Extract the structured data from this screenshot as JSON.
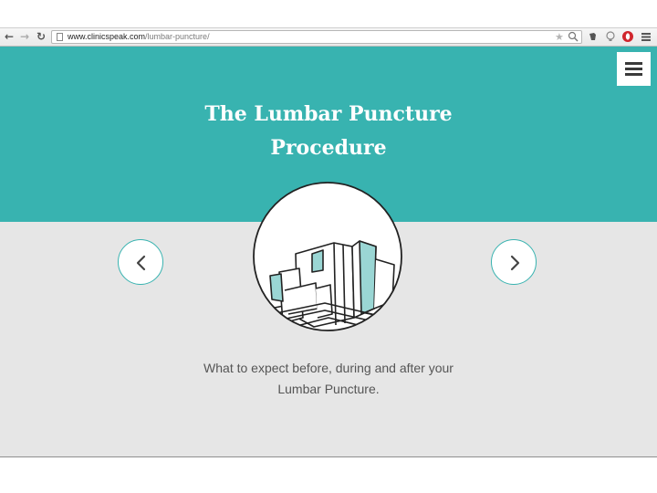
{
  "browser": {
    "url_domain": "www.clinicspeak.com",
    "url_path": "/lumbar-puncture/",
    "back_icon": "back-arrow-icon",
    "forward_icon": "forward-arrow-icon",
    "reload_icon": "reload-icon"
  },
  "hero": {
    "title_line1": "The Lumbar Puncture",
    "title_line2": "Procedure",
    "background_color": "#38b3b0"
  },
  "menu": {
    "icon": "hamburger-menu-icon"
  },
  "carousel": {
    "prev_icon": "chevron-left-icon",
    "next_icon": "chevron-right-icon",
    "illustration_icon": "building-illustration-icon",
    "accent_color": "#38b3b0"
  },
  "content": {
    "description_line1": "What to expect before, during and after your",
    "description_line2": "Lumbar Puncture."
  }
}
